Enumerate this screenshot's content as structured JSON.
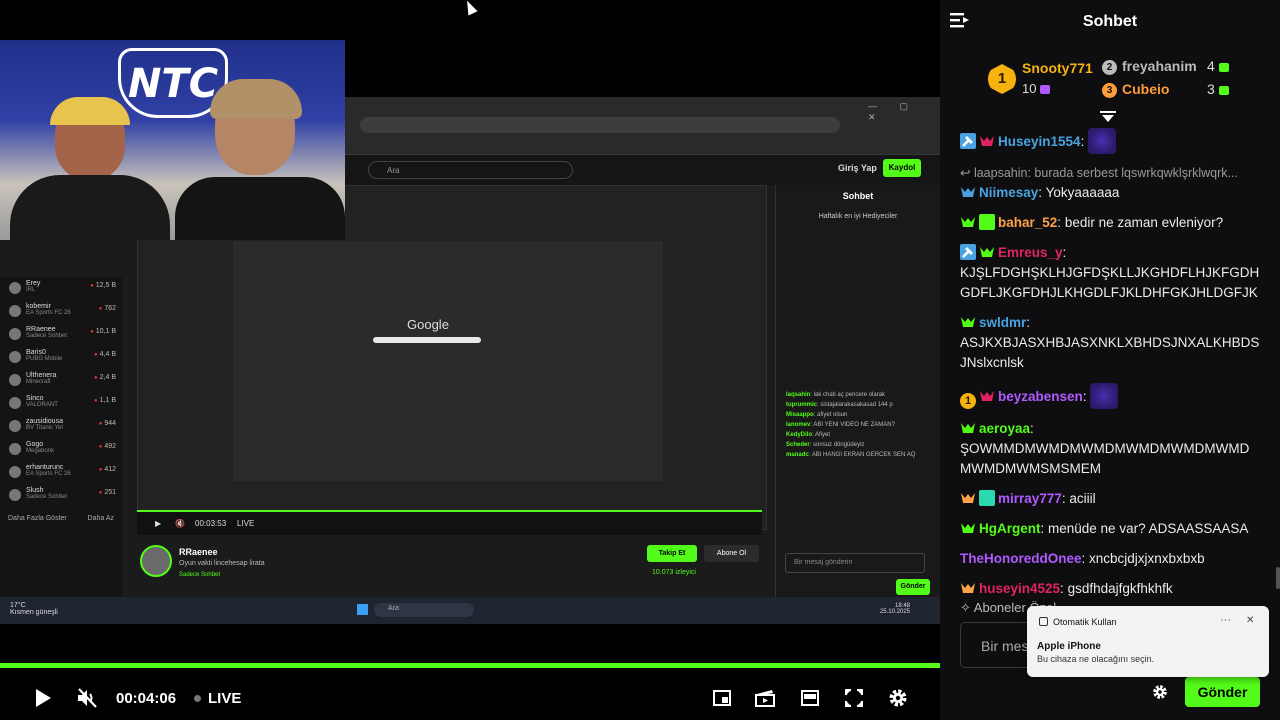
{
  "video": {
    "time": "00:04:06",
    "live_label": "LIVE",
    "progress_fraction": 1.0,
    "embedded_screen": {
      "search_placeholder": "Ara",
      "login": "Giriş Yap",
      "signup": "Kaydol",
      "sidebar_items": [
        {
          "name": "Erey",
          "sub": "IRL",
          "count": "12,5 B"
        },
        {
          "name": "kobemir",
          "sub": "EA Sports FC 26",
          "count": "762"
        },
        {
          "name": "RRaenee",
          "sub": "Sadece Sohbet",
          "count": "10,1 B"
        },
        {
          "name": "Baris0",
          "sub": "PUBG Mobile",
          "count": "4,4 B"
        },
        {
          "name": "Ulthenera",
          "sub": "Minecraft",
          "count": "2,4 B"
        },
        {
          "name": "Sinco",
          "sub": "VALORANT",
          "count": "1,1 B"
        },
        {
          "name": "zausidiousa",
          "sub": "BV Titanic Yet",
          "count": "944"
        },
        {
          "name": "Gogo",
          "sub": "Megabonk",
          "count": "492"
        },
        {
          "name": "erhanturunc",
          "sub": "EA Sports FC 26",
          "count": "412"
        },
        {
          "name": "Slush",
          "sub": "Sadece Sohbet",
          "count": "251"
        }
      ],
      "sidebar_more": "Daha Fazla Göster",
      "sidebar_less": "Daha Az",
      "google_text": "Google",
      "nested_chat_title": "Sohbet",
      "nested_chat_top": "Haftalık en iyi Hediyeciler",
      "nested_chat_lines": [
        {
          "user": "laqsahin",
          "text": "lak chati aç pencere olarak"
        },
        {
          "user": "tuprummic",
          "text": "sistajalarakasakasad 144 p"
        },
        {
          "user": "Misaappo",
          "text": "afiyet olsun"
        },
        {
          "user": "lanomev",
          "text": "ABI YENI VIDEO NE ZAMAN?"
        },
        {
          "user": "KedyDilo",
          "text": "Afiyet"
        },
        {
          "user": "Scheder",
          "text": "sonsuz döngüdeyiz"
        },
        {
          "user": "manadc",
          "text": "ABI HANGI EKRAN GERCEK SEN AQ"
        }
      ],
      "player_time": "00:03:53",
      "player_live": "LIVE",
      "channel_name": "RRaenee",
      "channel_desc": "Oyun vakti lincehesap lirata",
      "channel_cat": "Sadece Sohbet",
      "follow": "Takip Et",
      "subscribe": "Abone Ol",
      "viewers": "10.073 izleyici",
      "chat_placeholder": "Bir mesaj gönderin",
      "chat_send": "Gönder",
      "weather": "17°C",
      "weather_sub": "Kısmen güneşli",
      "taskbar_search": "Ara",
      "clock": "18:48",
      "date": "25.10.2025"
    }
  },
  "chat": {
    "title": "Sohbet",
    "leaderboard": {
      "first": {
        "rank": "1",
        "name": "Snooty771",
        "count": "10"
      },
      "second": {
        "rank": "2",
        "name": "freyahanim",
        "count": "4"
      },
      "third": {
        "rank": "3",
        "name": "Cubeio",
        "count": "3"
      }
    },
    "messages": [
      {
        "badges": [
          "mod",
          "fan-red"
        ],
        "user": "Huseyin1554",
        "color": "#4aa3e0",
        "sep": ":",
        "text": "",
        "emote": true
      },
      {
        "reply": "laapsahin: burada serbest lqswrkqwklşrklwqrk...",
        "badges": [
          "fan-blue"
        ],
        "user": "Niimesay",
        "color": "#4aa3e0",
        "sep": ":",
        "text": " Yokyaaaaaa"
      },
      {
        "badges": [
          "fan-green",
          "gift-green"
        ],
        "user": "bahar_52",
        "color": "#ffa24a",
        "sep": ":",
        "text": " bedir ne zaman evleniyor?"
      },
      {
        "badges": [
          "mod",
          "fan-green"
        ],
        "user": "Emreus_y",
        "color": "#e0245e",
        "sep": ":",
        "text": " KJŞLFDGHŞKLHJGFDŞKLLJKGHDFLHJKFGDHGDFLJKGFDHJLKHGDLFJKLDHFGKJHLDGFJK"
      },
      {
        "badges": [
          "fan-green"
        ],
        "user": "swldmr",
        "color": "#4aa3e0",
        "sep": ":",
        "text": " ASJKXBJASXHBJASXNKLXBHDSJNXALKHBDSJNslxcnlsk"
      },
      {
        "badges": [
          "rank-gold",
          "fan-red"
        ],
        "user": "beyzabensen",
        "color": "#b05aff",
        "sep": ":",
        "text": "",
        "emote": true
      },
      {
        "badges": [
          "fan-green"
        ],
        "user": "aeroyaa",
        "color": "#53fc18",
        "sep": ":",
        "text": " ŞOWMMDMWMDMWMDMWMDMWMDMWMDMWMDMWMSMSMEM"
      },
      {
        "badges": [
          "fan-orange",
          "gift-teal"
        ],
        "user": "mirray777",
        "color": "#b05aff",
        "sep": ":",
        "text": " aciiil"
      },
      {
        "badges": [
          "fan-green"
        ],
        "user": "HgArgent",
        "color": "#53fc18",
        "sep": ":",
        "text": " menüde ne var? ADSAASSAASA"
      },
      {
        "badges": [],
        "user": "TheHonoreddOnee",
        "color": "#b05aff",
        "sep": ":",
        "text": " xncbcjdjxjxnxbxbxb"
      },
      {
        "badges": [
          "fan-orange"
        ],
        "user": "huseyin4525",
        "color": "#e0245e",
        "sep": ":",
        "text": " gsdfhdajfgkfhkhfk"
      }
    ],
    "subs_label": "Aboneler Özel",
    "input_placeholder": "Bir mesaj gönderin",
    "send_label": "Gönder"
  },
  "notification": {
    "app": "Otomatik Kullan",
    "title": "Apple iPhone",
    "body": "Bu cihaza ne olacağını seçin."
  },
  "colors": {
    "accent": "#53fc18",
    "gold": "#f6b20f",
    "silver": "#bbbbbb",
    "bronze": "#ff9c3a",
    "mod_blue": "#4aa3e0"
  }
}
